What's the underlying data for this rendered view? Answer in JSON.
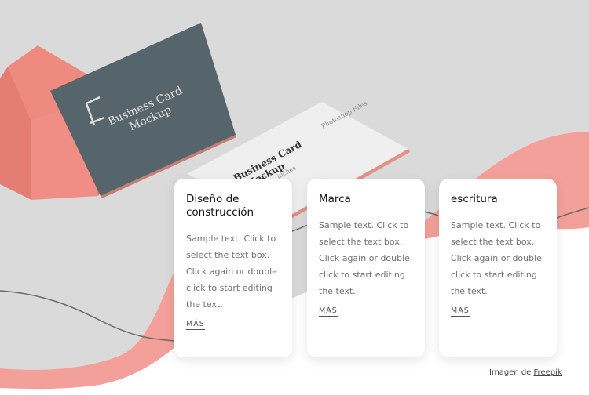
{
  "hero": {
    "image_alt": "Business card mockup on pink box",
    "card_front_line1": "Business Card",
    "card_front_line2": "Mockup",
    "card_back_line1": "Business Card",
    "card_back_line2": "Mockup",
    "card_back_small": "inches",
    "card_back_right": "Photoshop Files",
    "colors": {
      "background": "#dadada",
      "coral": "#f4a09a",
      "box": "#ef8a80",
      "slate": "#56646c",
      "wave_line": "#6b6b6b"
    }
  },
  "cards": [
    {
      "title": "Diseño de construcción",
      "body": "Sample text. Click to select the text box. Click again or double click to start editing the text.",
      "link": "MÁS"
    },
    {
      "title": "Marca",
      "body": "Sample text. Click to select the text box. Click again or double click to start editing the text.",
      "link": "MÁS"
    },
    {
      "title": "escritura",
      "body": "Sample text. Click to select the text box. Click again or double click to start editing the text.",
      "link": "MÁS"
    }
  ],
  "credit": {
    "prefix": "Imagen de",
    "link": "Freepik"
  }
}
